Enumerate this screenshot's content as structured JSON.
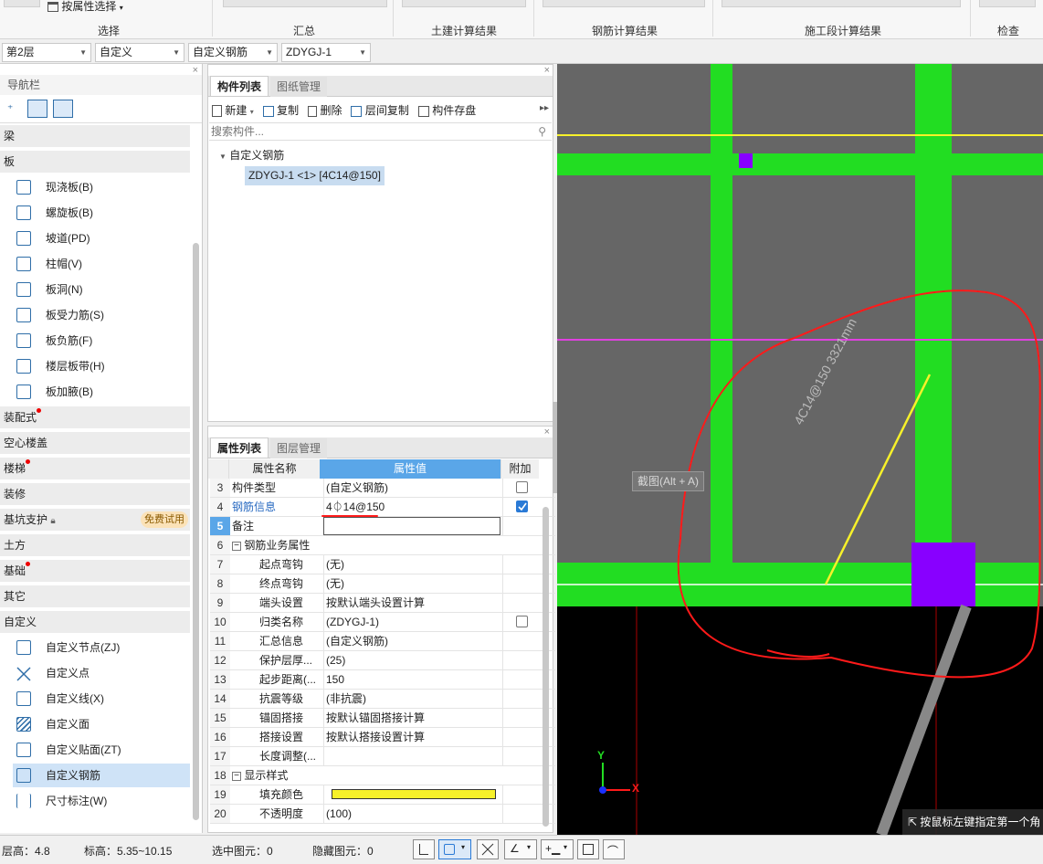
{
  "ribbon": {
    "attr_select": "按属性选择",
    "groups": [
      "选择",
      "汇总",
      "土建计算结果",
      "钢筋计算结果",
      "施工段计算结果",
      "检查"
    ]
  },
  "combos": {
    "floor": "第2层",
    "category": "自定义",
    "type": "自定义钢筋",
    "component": "ZDYGJ-1"
  },
  "nav": {
    "title": "导航栏",
    "categories": {
      "beam": "梁",
      "slab": "板",
      "prefab": "装配式",
      "hollow": "空心楼盖",
      "stairs": "楼梯",
      "decor": "装修",
      "pit": "基坑支护",
      "pit_badge": "免费试用",
      "earth": "土方",
      "found": "基础",
      "other": "其它",
      "custom": "自定义"
    },
    "slab_items": [
      "现浇板(B)",
      "螺旋板(B)",
      "坡道(PD)",
      "柱帽(V)",
      "板洞(N)",
      "板受力筋(S)",
      "板负筋(F)",
      "楼层板带(H)",
      "板加腋(B)"
    ],
    "custom_items": [
      "自定义节点(ZJ)",
      "自定义点",
      "自定义线(X)",
      "自定义面",
      "自定义贴面(ZT)",
      "自定义钢筋",
      "尺寸标注(W)"
    ]
  },
  "comp_panel": {
    "tab_list": "构件列表",
    "tab_drawing": "图纸管理",
    "toolbar": {
      "new": "新建",
      "copy": "复制",
      "delete": "删除",
      "floor_copy": "层间复制",
      "save": "构件存盘"
    },
    "search_placeholder": "搜索构件...",
    "tree_root": "自定义钢筋",
    "tree_item": "ZDYGJ-1 <1> [4C14@150]"
  },
  "prop_panel": {
    "tab_props": "属性列表",
    "tab_layers": "图层管理",
    "headers": {
      "name": "属性名称",
      "value": "属性值",
      "extra": "附加"
    },
    "rows": [
      {
        "n": "3",
        "k": "构件类型",
        "v": "(自定义钢筋)"
      },
      {
        "n": "4",
        "k": "钢筋信息",
        "v": "4⏀14@150"
      },
      {
        "n": "5",
        "k": "备注",
        "v": ""
      },
      {
        "n": "6",
        "k": "钢筋业务属性",
        "v": ""
      },
      {
        "n": "7",
        "k": "起点弯钩",
        "v": "(无)"
      },
      {
        "n": "8",
        "k": "终点弯钩",
        "v": "(无)"
      },
      {
        "n": "9",
        "k": "端头设置",
        "v": "按默认端头设置计算"
      },
      {
        "n": "10",
        "k": "归类名称",
        "v": "(ZDYGJ-1)"
      },
      {
        "n": "11",
        "k": "汇总信息",
        "v": "(自定义钢筋)"
      },
      {
        "n": "12",
        "k": "保护层厚...",
        "v": "(25)"
      },
      {
        "n": "13",
        "k": "起步距离(...",
        "v": "150"
      },
      {
        "n": "14",
        "k": "抗震等级",
        "v": "(非抗震)"
      },
      {
        "n": "15",
        "k": "锚固搭接",
        "v": "按默认锚固搭接计算"
      },
      {
        "n": "16",
        "k": "搭接设置",
        "v": "按默认搭接设置计算"
      },
      {
        "n": "17",
        "k": "长度调整(...",
        "v": ""
      },
      {
        "n": "18",
        "k": "显示样式",
        "v": ""
      },
      {
        "n": "19",
        "k": "填充颜色",
        "v": ""
      },
      {
        "n": "20",
        "k": "不透明度",
        "v": "(100)"
      }
    ]
  },
  "canvas": {
    "rebar_label": "4C14@150 3321mm",
    "screenshot_tip": "截图(Alt + A)",
    "hint": "按鼠标左键指定第一个角",
    "axis_x": "X",
    "axis_y": "Y"
  },
  "colors": {
    "beam": "#22dd22",
    "fill": "#f7f12a",
    "purple": "#8800ff",
    "annotation": "#ff1a1a"
  },
  "status": {
    "floor_height": "层高：4.8",
    "elevation": "标高：5.35~10.15",
    "selected": "选中图元：0",
    "hidden": "隐藏图元：0"
  }
}
